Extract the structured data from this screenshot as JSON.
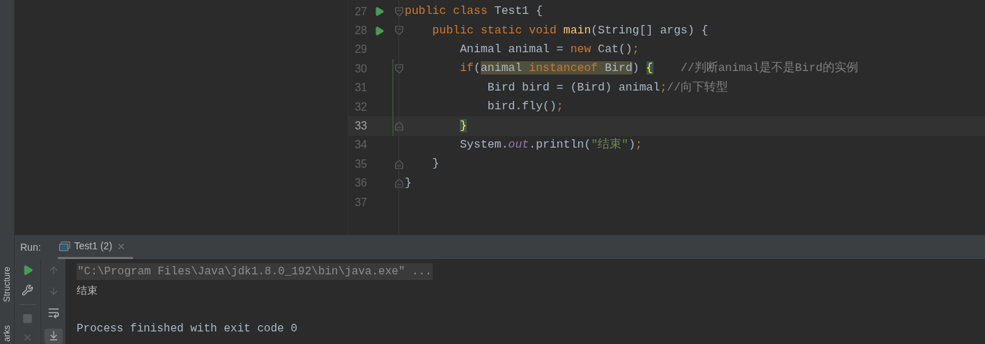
{
  "left_strip": {
    "labels": [
      "Structure",
      "arks"
    ]
  },
  "editor": {
    "lines": [
      {
        "number": "27",
        "run": true,
        "fold_open": true,
        "fold_close": false,
        "changed": false,
        "current": false,
        "tokens": [
          {
            "kind": "keyword",
            "text": "public class "
          },
          {
            "kind": "plain",
            "text": "Test1 {"
          }
        ]
      },
      {
        "number": "28",
        "run": true,
        "fold_open": true,
        "fold_close": false,
        "changed": false,
        "current": false,
        "tokens": [
          {
            "kind": "keyword",
            "text": "    public static void "
          },
          {
            "kind": "method",
            "text": "main"
          },
          {
            "kind": "plain",
            "text": "(String[] args) {"
          }
        ]
      },
      {
        "number": "29",
        "run": false,
        "fold_open": false,
        "fold_close": false,
        "changed": false,
        "current": false,
        "tokens": [
          {
            "kind": "plain",
            "text": "        Animal animal = "
          },
          {
            "kind": "keyword",
            "text": "new "
          },
          {
            "kind": "plain",
            "text": "Cat()"
          },
          {
            "kind": "keyword",
            "text": ";"
          }
        ]
      },
      {
        "number": "30",
        "run": false,
        "fold_open": true,
        "fold_close": false,
        "changed": true,
        "current": false,
        "tokens": [
          {
            "kind": "keyword",
            "text": "        if"
          },
          {
            "kind": "plain",
            "text": "("
          },
          {
            "kind": "plain",
            "text": "animal ",
            "usage": true
          },
          {
            "kind": "keyword",
            "text": "instanceof ",
            "usage": true
          },
          {
            "kind": "plain",
            "text": "Bird",
            "usage": true
          },
          {
            "kind": "plain",
            "text": ") "
          },
          {
            "kind": "plain",
            "text": "{",
            "matched_brace": true
          },
          {
            "kind": "comment",
            "text": "    //判断animal是不是Bird的实例"
          }
        ]
      },
      {
        "number": "31",
        "run": false,
        "fold_open": false,
        "fold_close": false,
        "changed": true,
        "current": false,
        "tokens": [
          {
            "kind": "plain",
            "text": "            Bird bird = (Bird) animal"
          },
          {
            "kind": "keyword",
            "text": ";"
          },
          {
            "kind": "comment",
            "text": "//向下转型"
          }
        ]
      },
      {
        "number": "32",
        "run": false,
        "fold_open": false,
        "fold_close": false,
        "changed": true,
        "current": false,
        "tokens": [
          {
            "kind": "plain",
            "text": "            bird.fly()"
          },
          {
            "kind": "keyword",
            "text": ";"
          }
        ]
      },
      {
        "number": "33",
        "run": false,
        "fold_open": false,
        "fold_close": true,
        "changed": true,
        "current": true,
        "tokens": [
          {
            "kind": "plain",
            "text": "        }",
            "matched_brace": true
          }
        ]
      },
      {
        "number": "34",
        "run": false,
        "fold_open": false,
        "fold_close": false,
        "changed": false,
        "current": false,
        "tokens": [
          {
            "kind": "plain",
            "text": "        System."
          },
          {
            "kind": "field",
            "text": "out"
          },
          {
            "kind": "plain",
            "text": ".println("
          },
          {
            "kind": "string",
            "text": "\"结束\""
          },
          {
            "kind": "plain",
            "text": ")"
          },
          {
            "kind": "keyword",
            "text": ";"
          }
        ]
      },
      {
        "number": "35",
        "run": false,
        "fold_open": false,
        "fold_close": true,
        "changed": false,
        "current": false,
        "tokens": [
          {
            "kind": "plain",
            "text": "    }"
          }
        ]
      },
      {
        "number": "36",
        "run": false,
        "fold_open": false,
        "fold_close": true,
        "changed": false,
        "current": false,
        "tokens": [
          {
            "kind": "plain",
            "text": "}"
          }
        ]
      },
      {
        "number": "37",
        "run": false,
        "fold_open": false,
        "fold_close": false,
        "changed": false,
        "current": false
      }
    ]
  },
  "run_panel": {
    "label": "Run:",
    "tabs": [
      {
        "label": "Test1 (2)",
        "selected": true
      }
    ],
    "console": [
      {
        "kind": "command",
        "text": "\"C:\\Program Files\\Java\\jdk1.8.0_192\\bin\\java.exe\" ..."
      },
      {
        "kind": "output",
        "text": "结束"
      },
      {
        "kind": "status",
        "text": "Process finished with exit code 0"
      }
    ]
  }
}
